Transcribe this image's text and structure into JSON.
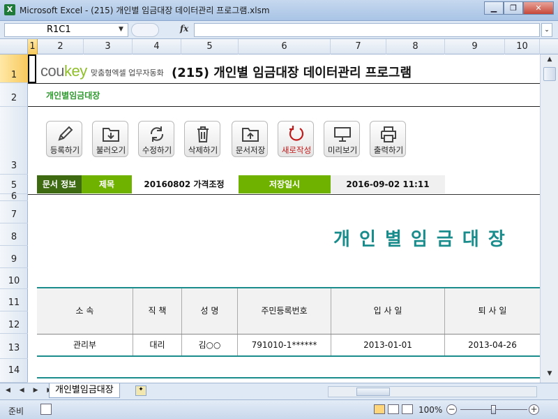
{
  "window": {
    "title": "Microsoft Excel - (215) 개인별 임금대장 데이터관리 프로그램.xlsm",
    "app_icon": "X",
    "minimize": "▁",
    "restore": "❐",
    "close": "✕"
  },
  "formula_bar": {
    "name_box": "R1C1",
    "fx": "fx",
    "value": ""
  },
  "columns": [
    "1",
    "2",
    "3",
    "4",
    "5",
    "6",
    "7",
    "8",
    "9",
    "10"
  ],
  "rows": [
    "1",
    "2",
    "3",
    "5",
    "6",
    "7",
    "8",
    "9",
    "10",
    "11",
    "12",
    "13",
    "14"
  ],
  "header": {
    "logo_co": "cou",
    "logo_key": "key",
    "logo_sub": "맞춤형엑셀 업무자동화",
    "program_title": "(215) 개인별 임금대장 데이터관리 프로그램",
    "sheet_subtitle": "개인별임금대장"
  },
  "toolbar": [
    {
      "label": "등록하기",
      "icon": "pencil-icon"
    },
    {
      "label": "불러오기",
      "icon": "folder-download-icon"
    },
    {
      "label": "수정하기",
      "icon": "refresh-icon"
    },
    {
      "label": "삭제하기",
      "icon": "trash-icon"
    },
    {
      "label": "문서저장",
      "icon": "folder-upload-icon"
    },
    {
      "label": "새로작성",
      "icon": "new-doc-circle-icon"
    },
    {
      "label": "미리보기",
      "icon": "monitor-icon"
    },
    {
      "label": "출력하기",
      "icon": "printer-icon"
    }
  ],
  "doc_info": {
    "section_label": "문서 정보",
    "title_label": "제목",
    "title_value": "20160802 가격조정",
    "saved_label": "저장일시",
    "saved_value": "2016-09-02 11:11"
  },
  "main_title": "개 인 별 임 금 대 장",
  "table": {
    "headers": [
      "소 속",
      "직 책",
      "성 명",
      "주민등록번호",
      "입 사 일",
      "퇴 사 일"
    ],
    "row": [
      "관리부",
      "대리",
      "김○○",
      "791010-1******",
      "2013-01-01",
      "2013-04-26"
    ]
  },
  "sheet_tabs": {
    "nav": "◀ ◀ ▶ ▶",
    "active": "개인별임금대장"
  },
  "status": {
    "ready": "준비",
    "zoom": "100%"
  },
  "colors": {
    "accent_teal": "#1b8c8c",
    "green_dark": "#3e6b12",
    "green_light": "#6fb200",
    "subtitle_green": "#2e9a2e"
  }
}
